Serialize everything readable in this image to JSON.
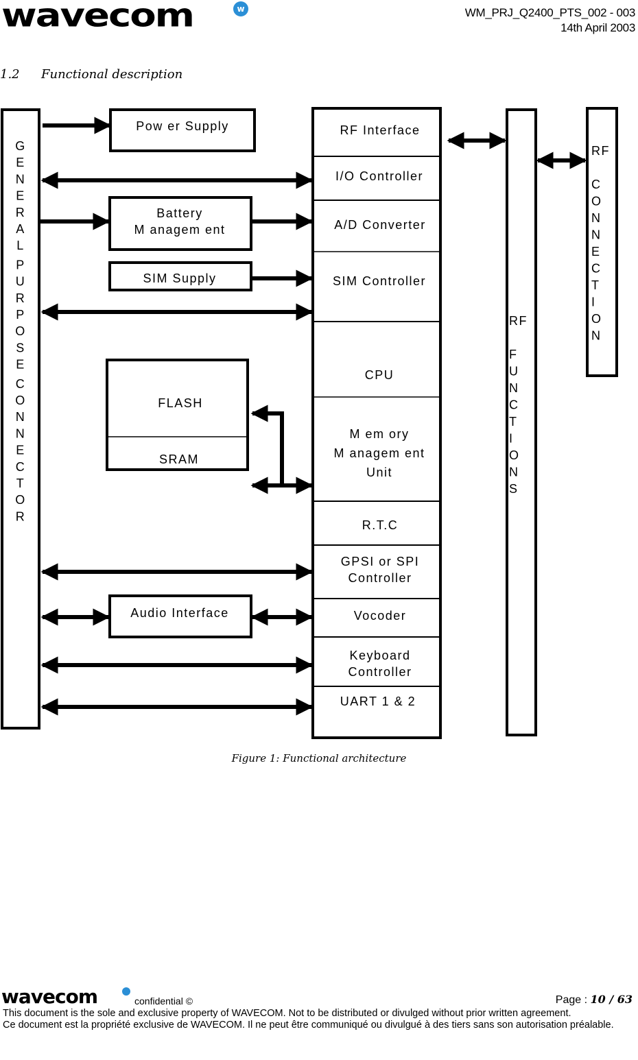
{
  "header": {
    "logo_text": "wavecom",
    "logo_mark": "w",
    "doc_id": "WM_PRJ_Q2400_PTS_002  - 003",
    "date": "14th April 2003"
  },
  "section": {
    "number": "1.2",
    "title": "Functional description"
  },
  "diagram": {
    "general_purpose_connector": [
      "G",
      "E",
      "N",
      "E",
      "R",
      "A",
      "L",
      "P",
      "U",
      "R",
      "P",
      "O",
      "S",
      "E",
      "C",
      "O",
      "N",
      "N",
      "E",
      "C",
      "T",
      "O",
      "R"
    ],
    "blocks": {
      "power_supply": "Pow er Supply",
      "battery_management_1": "Battery",
      "battery_management_2": "M anagem ent",
      "sim_supply": "SIM  Supply",
      "flash": "FLASH",
      "sram": "SRAM",
      "audio_interface": "Audio Interface"
    },
    "core": {
      "rf_interface": "RF Interface",
      "io_controller": "I/O Controller",
      "ad_converter": "A/D Converter",
      "sim_controller": "SIM  Controller",
      "cpu": "CPU",
      "mmu_1": "M em ory",
      "mmu_2": "M anagem ent",
      "mmu_3": "Unit",
      "rtc": "R.T.C",
      "gpsi_1": "GPSI or SPI",
      "gpsi_2": "Controller",
      "vocoder": "Vocoder",
      "keyboard_1": "Keyboard",
      "keyboard_2": "Controller",
      "uart": "UART 1 & 2"
    },
    "rf_functions": [
      "RF",
      "",
      "F",
      "U",
      "N",
      "C",
      "T",
      "I",
      "O",
      "N",
      "S"
    ],
    "rf_connection": [
      "RF",
      "",
      "C",
      "O",
      "N",
      "N",
      "E",
      "C",
      "T",
      "I",
      "O",
      "N"
    ]
  },
  "caption": "Figure 1: Functional architecture",
  "footer": {
    "logo_text": "wavecom",
    "confidential": "confidential ©",
    "page_label": "Page : ",
    "page_number": "10 / 63",
    "disclaimer_en": "This document is the sole and exclusive property of WAVECOM. Not to be distributed or divulged without prior written agreement.",
    "disclaimer_fr": "Ce document est la propriété exclusive de WAVECOM. Il ne peut être communiqué ou divulgué à des tiers sans son autorisation préalable."
  }
}
